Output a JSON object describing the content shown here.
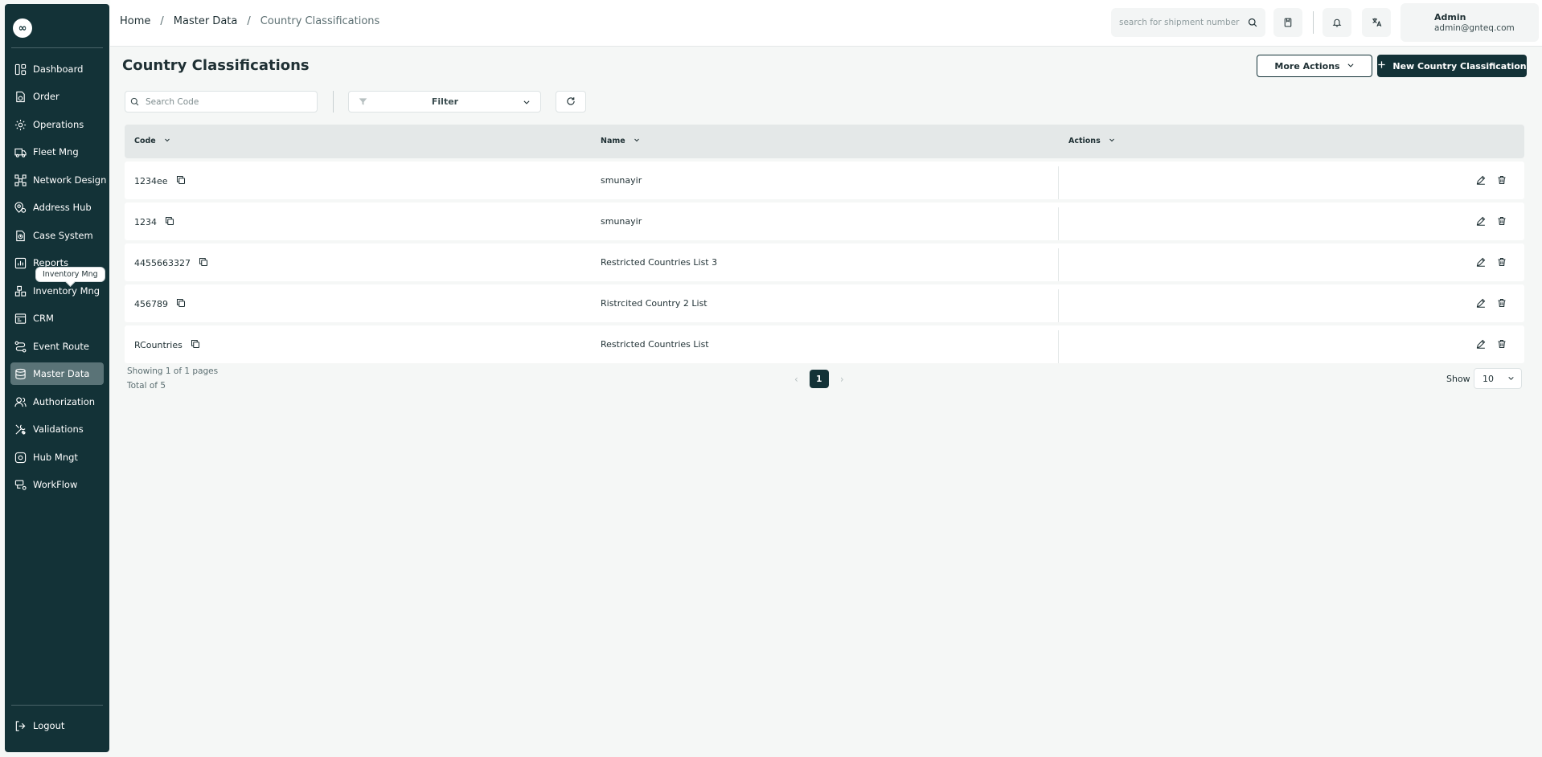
{
  "sidebar": {
    "logo": "∞",
    "items": [
      {
        "label": "Dashboard",
        "icon": "dashboard-icon"
      },
      {
        "label": "Order",
        "icon": "order-icon"
      },
      {
        "label": "Operations",
        "icon": "operations-icon"
      },
      {
        "label": "Fleet Mng",
        "icon": "truck-icon"
      },
      {
        "label": "Network Design",
        "icon": "network-icon"
      },
      {
        "label": "Address Hub",
        "icon": "location-icon"
      },
      {
        "label": "Case System",
        "icon": "case-icon"
      },
      {
        "label": "Reports",
        "icon": "reports-icon"
      },
      {
        "label": "Inventory Mng",
        "icon": "inventory-icon"
      },
      {
        "label": "CRM",
        "icon": "crm-icon"
      },
      {
        "label": "Event Route",
        "icon": "route-icon"
      },
      {
        "label": "Master Data",
        "icon": "database-icon",
        "active": true
      },
      {
        "label": "Authorization",
        "icon": "users-icon"
      },
      {
        "label": "Validations",
        "icon": "tools-icon"
      },
      {
        "label": "Hub Mngt",
        "icon": "hub-icon"
      },
      {
        "label": "WorkFlow",
        "icon": "workflow-icon"
      }
    ],
    "tooltip": "Inventory Mng",
    "logout_label": "Logout"
  },
  "header": {
    "breadcrumb": [
      "Home",
      "Master Data",
      "Country Classifications"
    ],
    "search_placeholder": "search for shipment number",
    "user_name": "Admin",
    "user_email": "admin@gnteq.com"
  },
  "page": {
    "title": "Country Classifications",
    "more_actions_label": "More Actions",
    "new_label": "New Country Classification",
    "code_search_placeholder": "Search Code",
    "filter_label": "Filter"
  },
  "table": {
    "columns": [
      "Code",
      "Name",
      "Actions"
    ],
    "rows": [
      {
        "code": "1234ee",
        "name": "smunayir"
      },
      {
        "code": "1234",
        "name": "smunayir"
      },
      {
        "code": "4455663327",
        "name": "Restricted Countries List 3"
      },
      {
        "code": "456789",
        "name": "Ristrcited Country 2 List"
      },
      {
        "code": "RCountries",
        "name": "Restricted Countries List"
      }
    ]
  },
  "pagination": {
    "showing": "Showing 1 of 1 pages",
    "total": "Total of 5",
    "current_page": "1",
    "show_label": "Show",
    "page_size": "10"
  },
  "colors": {
    "brand": "#133237",
    "active_nav": "#5a7377",
    "table_header": "#e4e8e8"
  }
}
